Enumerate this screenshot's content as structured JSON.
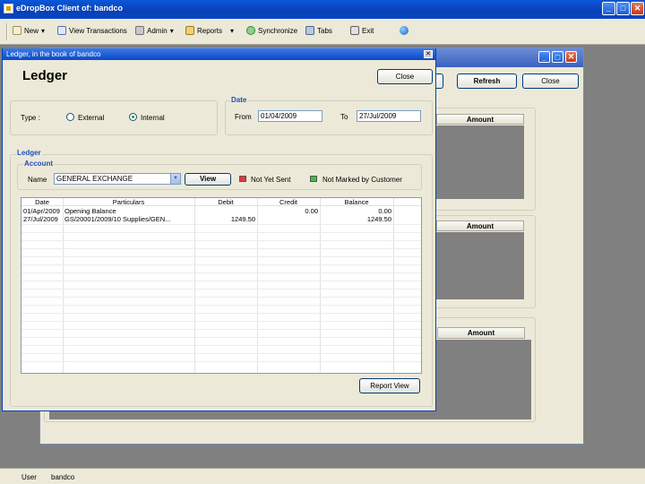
{
  "app": {
    "title": "eDropBox Client of: bandco",
    "win_buttons": {
      "minimize": "_",
      "maximize": "□",
      "close": "✕"
    }
  },
  "toolbar": {
    "items": [
      {
        "label": "New",
        "icon": "new-icon",
        "dropdown": true
      },
      {
        "label": "View Transactions",
        "icon": "transactions-icon"
      },
      {
        "label": "Admin",
        "icon": "admin-icon",
        "dropdown": true
      },
      {
        "label": "Reports",
        "icon": "reports-icon",
        "dropdown": true
      },
      {
        "label": "Synchronize",
        "icon": "sync-icon"
      },
      {
        "label": "Tabs",
        "icon": "tabs-icon"
      },
      {
        "label": "Exit",
        "icon": "exit-icon"
      },
      {
        "label": "",
        "icon": "globe-icon"
      }
    ],
    "dropdown_arrow": "▾"
  },
  "background_window": {
    "refresh_label": "Refresh",
    "close_label": "Close",
    "amount_headers": [
      "Amount",
      "Amount",
      "Amount"
    ]
  },
  "ledger_window": {
    "title": "Ledger, in the book of bandco",
    "close_x": "✕",
    "heading": "Ledger",
    "close_label": "Close",
    "type": {
      "label": "Type :",
      "options": [
        "External",
        "Internal"
      ],
      "selected": "Internal"
    },
    "date": {
      "legend": "Date",
      "from_label": "From",
      "from_value": "01/04/2009",
      "to_label": "To",
      "to_value": "27/Jul/2009"
    },
    "ledger_legend": "Ledger",
    "account": {
      "legend": "Account",
      "name_label": "Name",
      "name_value": "GENERAL EXCHANGE",
      "view_label": "View",
      "not_yet_sent_label": "Not Yet Sent",
      "not_marked_label": "Not Marked by Customer",
      "not_yet_sent_color": "#e23b3b",
      "not_marked_color": "#3bc43b"
    },
    "table": {
      "columns": [
        "Date",
        "Particulars",
        "Debit",
        "Credit",
        "Balance"
      ],
      "rows": [
        [
          "01/Apr/2009",
          "Opening Balance",
          "",
          "0.00",
          "0.00"
        ],
        [
          "27/Jul/2009",
          "GS/20001/2009/10  Supplies/GEN...",
          "1249.50",
          "",
          "1249.50"
        ]
      ]
    },
    "report_view_label": "Report View"
  },
  "statusbar": {
    "user_label": "User",
    "user_value": "bandco"
  }
}
